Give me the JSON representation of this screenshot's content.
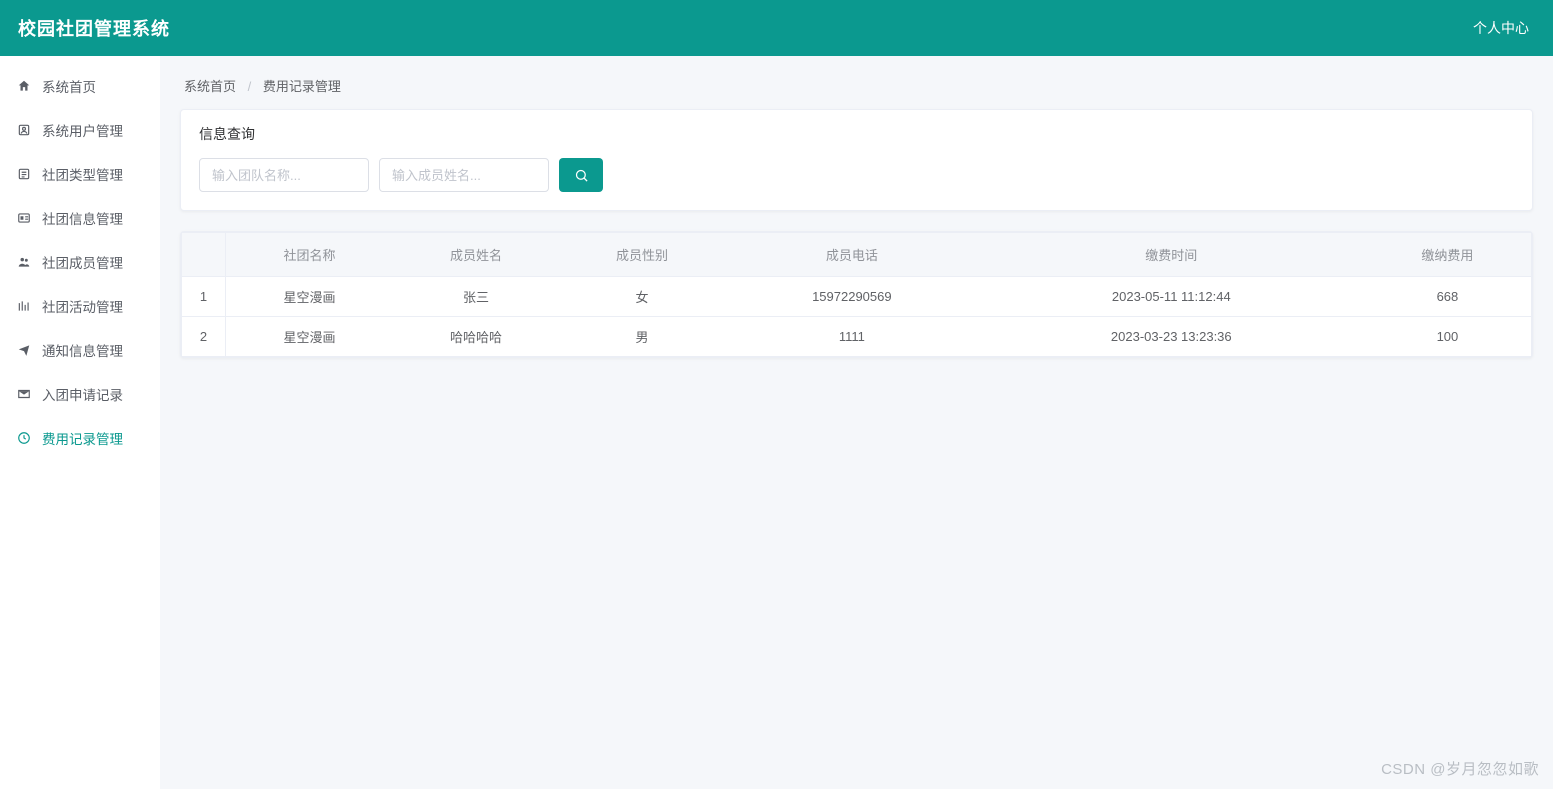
{
  "header": {
    "title": "校园社团管理系统",
    "personal_center": "个人中心"
  },
  "sidebar": {
    "items": [
      {
        "label": "系统首页",
        "icon": "home-icon"
      },
      {
        "label": "系统用户管理",
        "icon": "user-icon"
      },
      {
        "label": "社团类型管理",
        "icon": "list-icon"
      },
      {
        "label": "社团信息管理",
        "icon": "info-icon"
      },
      {
        "label": "社团成员管理",
        "icon": "members-icon"
      },
      {
        "label": "社团活动管理",
        "icon": "activity-icon"
      },
      {
        "label": "通知信息管理",
        "icon": "bell-icon"
      },
      {
        "label": "入团申请记录",
        "icon": "mail-icon"
      },
      {
        "label": "费用记录管理",
        "icon": "clock-icon"
      }
    ],
    "active_index": 8
  },
  "breadcrumb": {
    "root": "系统首页",
    "current": "费用记录管理"
  },
  "query": {
    "title": "信息查询",
    "team_placeholder": "输入团队名称...",
    "member_placeholder": "输入成员姓名..."
  },
  "table": {
    "headers": [
      "社团名称",
      "成员姓名",
      "成员性别",
      "成员电话",
      "缴费时间",
      "缴纳费用"
    ],
    "rows": [
      {
        "idx": "1",
        "club": "星空漫画",
        "name": "张三",
        "gender": "女",
        "phone": "15972290569",
        "time": "2023-05-11 11:12:44",
        "fee": "668"
      },
      {
        "idx": "2",
        "club": "星空漫画",
        "name": "哈哈哈哈",
        "gender": "男",
        "phone": "1111",
        "time": "2023-03-23 13:23:36",
        "fee": "100"
      }
    ]
  },
  "watermark": "CSDN @岁月忽忽如歌"
}
